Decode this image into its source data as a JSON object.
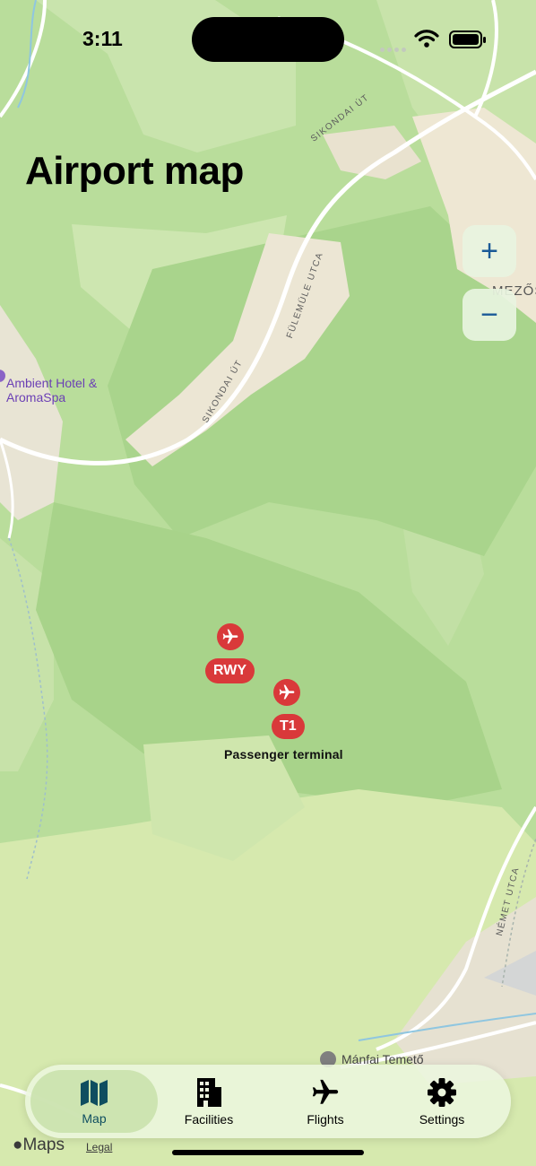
{
  "status_bar": {
    "time": "3:11"
  },
  "page": {
    "title": "Airport map"
  },
  "zoom": {
    "in_label": "+",
    "out_label": "−"
  },
  "map": {
    "streets": [
      "SIKONDAI ÚT",
      "FÜLEMÜLE UTCA",
      "SIKONDAI ÚT",
      "NÉMET UTCA"
    ],
    "place_partial": "MEZŐS",
    "poi_hotel": {
      "line1": "Ambient Hotel &",
      "line2": "AromaSpa"
    },
    "poi_cemetery": "Mánfai Temető"
  },
  "pins": [
    {
      "badge": "RWY",
      "caption": "",
      "icon": "airplane-icon"
    },
    {
      "badge": "T1",
      "caption": "Passenger terminal",
      "icon": "airplane-icon"
    }
  ],
  "tabs": [
    {
      "label": "Map",
      "icon": "map-icon",
      "active": true
    },
    {
      "label": "Facilities",
      "icon": "building-icon",
      "active": false
    },
    {
      "label": "Flights",
      "icon": "airplane-icon",
      "active": false
    },
    {
      "label": "Settings",
      "icon": "gear-icon",
      "active": false
    }
  ],
  "attribution": {
    "brand": "Maps",
    "legal": "Legal"
  },
  "colors": {
    "accent": "#0f4e60",
    "pin": "#d9393a",
    "zoom_icon": "#1a5a97",
    "poi": "#6b3fb5"
  }
}
